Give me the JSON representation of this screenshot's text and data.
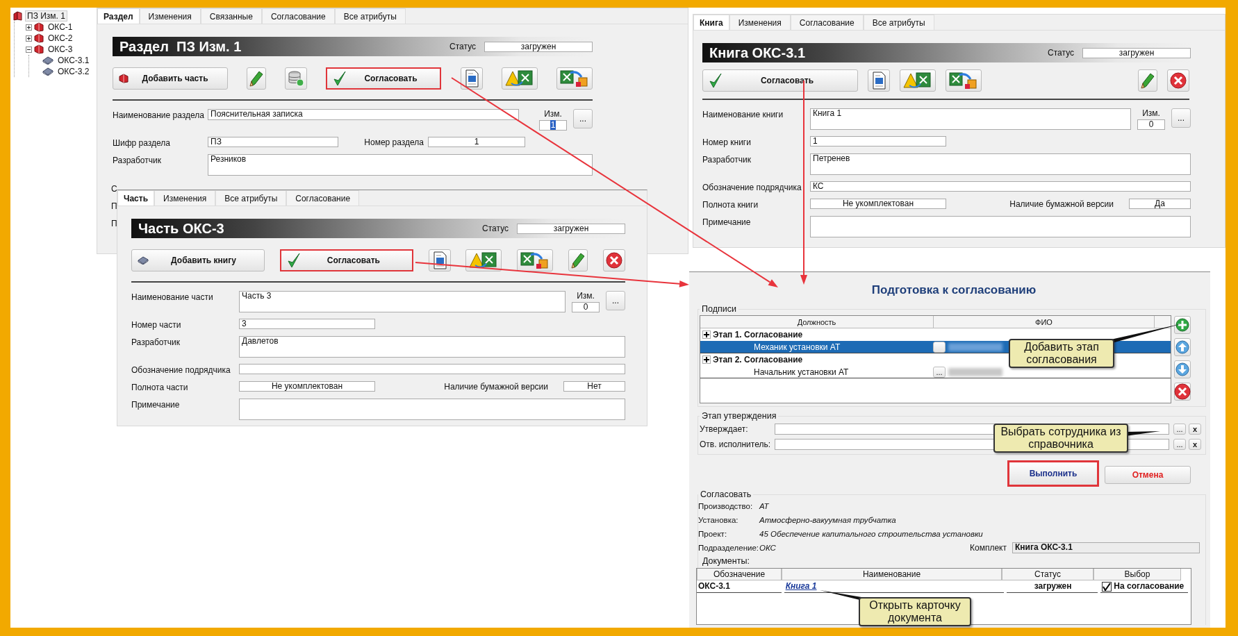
{
  "tree": [
    {
      "label": "ПЗ Изм. 1",
      "kind": "set",
      "selected": true,
      "children": [
        {
          "label": "ОКС-1",
          "kind": "part",
          "expanded": false,
          "selected": false
        },
        {
          "label": "ОКС-2",
          "kind": "part",
          "expanded": false,
          "selected": false
        },
        {
          "label": "ОКС-3",
          "kind": "part",
          "expanded": true,
          "selected": false,
          "children": [
            {
              "label": "ОКС-3.1",
              "kind": "book",
              "selected": false
            },
            {
              "label": "ОКС-3.2",
              "kind": "book",
              "selected": false
            }
          ]
        }
      ]
    }
  ],
  "section_card": {
    "tabs": [
      {
        "label": "Раздел",
        "selected": true
      },
      {
        "label": "Изменения",
        "selected": false
      },
      {
        "label": "Связанные",
        "selected": false
      },
      {
        "label": "Согласование",
        "selected": false
      },
      {
        "label": "Все атрибуты",
        "selected": false
      }
    ],
    "title": "Раздел  ПЗ Изм. 1",
    "status_label": "Статус",
    "status": "загружен",
    "toolbar": [
      {
        "kind": "add-part",
        "label": "Добавить часть"
      },
      {
        "kind": "pencil"
      },
      {
        "kind": "database"
      },
      {
        "kind": "approve",
        "label": "Согласовать",
        "highlighted": true
      },
      {
        "kind": "word"
      },
      {
        "kind": "warn-excel"
      },
      {
        "kind": "excel-transfer"
      }
    ],
    "fields": [
      {
        "kind": "name",
        "label": "Наименование раздела",
        "value": "Пояснительная записка",
        "rev_label": "Изм.",
        "rev": "1",
        "rev_selected": true,
        "more": "..."
      },
      {
        "kind": "pair",
        "label": "Шифр раздела",
        "value": "ПЗ",
        "label_2": "Номер раздела",
        "value_2": "1"
      },
      {
        "kind": "area",
        "label": "Разработчик",
        "value": "Резников"
      }
    ],
    "covered_labels": [
      "С",
      "П",
      "П"
    ]
  },
  "part_card": {
    "tabs": [
      {
        "label": "Часть",
        "selected": true
      },
      {
        "label": "Изменения",
        "selected": false
      },
      {
        "label": "Все атрибуты",
        "selected": false
      },
      {
        "label": "Согласование",
        "selected": false
      }
    ],
    "title": "Часть ОКС-3",
    "status_label": "Статус",
    "status": "загружен",
    "toolbar": [
      {
        "kind": "add-book",
        "label": "Добавить книгу"
      },
      {
        "kind": "approve",
        "label": "Согласовать",
        "highlighted": true
      },
      {
        "kind": "word"
      },
      {
        "kind": "warn-excel"
      },
      {
        "kind": "excel-transfer"
      },
      {
        "kind": "pencil"
      },
      {
        "kind": "close"
      }
    ],
    "fields": [
      {
        "kind": "name",
        "label": "Наименование части",
        "value": "Часть 3",
        "rev_label": "Изм.",
        "rev": "0",
        "rev_selected": false,
        "more": "..."
      },
      {
        "kind": "short",
        "label": "Номер части",
        "value": "3"
      },
      {
        "kind": "area",
        "label": "Разработчик",
        "value": "Давлетов"
      },
      {
        "kind": "line",
        "label": "Обозначение подрядчика"
      },
      {
        "kind": "choice-pair",
        "label": "Полнота части",
        "value": "Не укомплектован",
        "label_2": "Наличие бумажной версии",
        "value_2": "Нет"
      },
      {
        "kind": "area",
        "label": "Примечание"
      }
    ]
  },
  "book_card": {
    "tabs": [
      {
        "label": "Книга",
        "selected": true
      },
      {
        "label": "Изменения",
        "selected": false
      },
      {
        "label": "Согласование",
        "selected": false
      },
      {
        "label": "Все атрибуты",
        "selected": false
      }
    ],
    "title": "Книга ОКС-3.1",
    "status_label": "Статус",
    "status": "загружен",
    "toolbar": [
      {
        "kind": "approve",
        "label": "Согласовать",
        "highlighted": false
      },
      {
        "kind": "word"
      },
      {
        "kind": "warn-excel"
      },
      {
        "kind": "excel-transfer"
      },
      {
        "kind": "pencil"
      },
      {
        "kind": "close"
      }
    ],
    "fields": [
      {
        "kind": "name",
        "label": "Наименование книги",
        "value": "Книга 1",
        "rev_label": "Изм.",
        "rev": "0",
        "rev_selected": false,
        "more": "..."
      },
      {
        "kind": "short",
        "label": "Номер книги",
        "value": "1"
      },
      {
        "kind": "area",
        "label": "Разработчик",
        "value": "Петренев"
      },
      {
        "kind": "line",
        "label": "Обозначение подрядчика",
        "value": "КС"
      },
      {
        "kind": "choice-pair",
        "label": "Полнота книги",
        "value": "Не укомплектован",
        "label_2": "Наличие бумажной версии",
        "value_2": "Да"
      },
      {
        "kind": "area",
        "label": "Примечание"
      }
    ]
  },
  "dialog": {
    "title": "Подготовка к согласованию",
    "signatures": {
      "legend": "Подписи",
      "columns": [
        "Должность",
        "ФИО"
      ],
      "rows": [
        {
          "kind": "stage",
          "label": "Этап 1. Согласование",
          "expanded": false
        },
        {
          "kind": "signer",
          "label": "Механик установки АТ",
          "selected": true
        },
        {
          "kind": "stage",
          "label": "Этап 2. Согласование",
          "expanded": false
        },
        {
          "kind": "signer",
          "label": "Начальник установки АТ",
          "selected": false,
          "picker": "..."
        }
      ]
    },
    "approval": {
      "legend": "Этап утверждения",
      "rows": [
        {
          "label": "Утверждает:",
          "picker": "...",
          "clear": "x"
        },
        {
          "label": "Отв. исполнитель:",
          "picker": "...",
          "clear": "x"
        }
      ]
    },
    "actions": [
      {
        "kind": "primary",
        "label": "Выполнить",
        "highlighted": true
      },
      {
        "kind": "cancel",
        "label": "Отмена",
        "highlighted": false
      }
    ],
    "summary": {
      "legend": "Согласовать",
      "items": [
        {
          "label": "Производство:",
          "value": "АТ"
        },
        {
          "label": "Установка:",
          "value": "Атмосферно-вакуумная трубчатка"
        },
        {
          "label": "Проект:",
          "value": "45 Обеспечение капитального строительства установки"
        },
        {
          "label": "Подразделение:",
          "value": "ОКС"
        }
      ],
      "set_label": "Комплект",
      "set_value": "Книга ОКС-3.1",
      "documents_label": "Документы:",
      "table": {
        "columns": [
          "Обозначение",
          "Наименование",
          "Статус",
          "Выбор"
        ],
        "rows": [
          {
            "code": "ОКС-3.1",
            "name": "Книга 1",
            "status": "загружен",
            "checked": true,
            "choice": "На согласование"
          }
        ]
      }
    }
  },
  "callouts": [
    {
      "text": "Добавить этап согласования"
    },
    {
      "text": "Выбрать сотрудника из справочника"
    },
    {
      "text": "Открыть карточку документа"
    }
  ]
}
